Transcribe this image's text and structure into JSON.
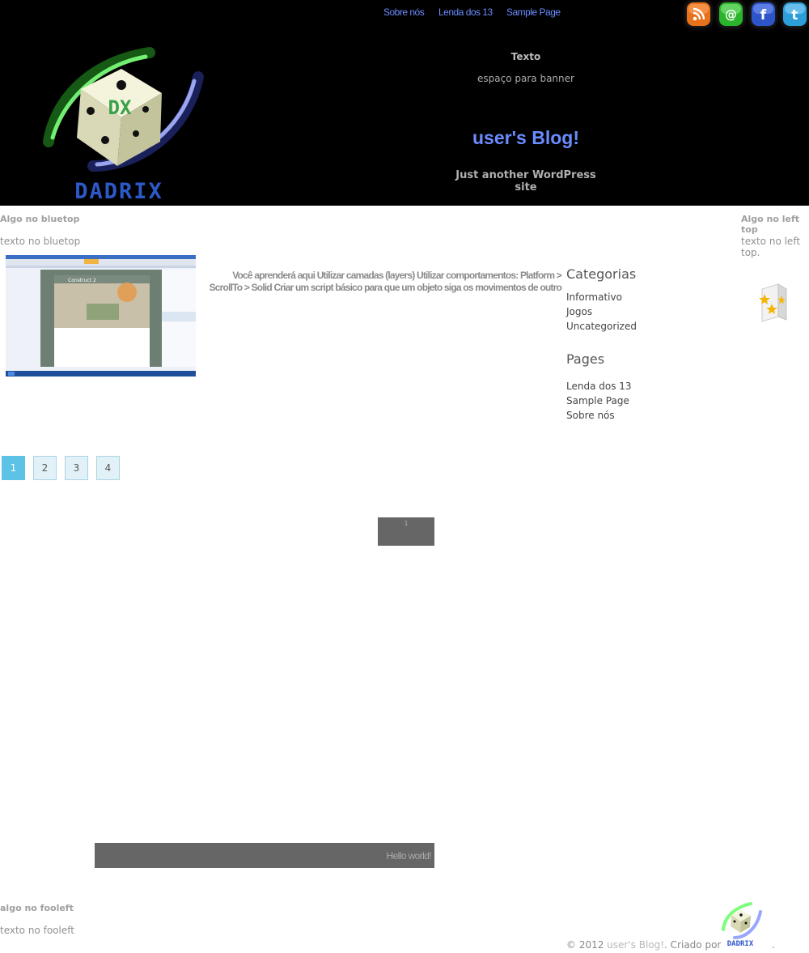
{
  "nav": {
    "items": [
      {
        "label": "Sobre nós"
      },
      {
        "label": "Lenda dos 13"
      },
      {
        "label": "Sample Page"
      }
    ]
  },
  "social_icons": [
    {
      "icon": "rss-icon",
      "color": "#e8721c"
    },
    {
      "icon": "email-icon",
      "color": "#2bb32b"
    },
    {
      "icon": "facebook-icon",
      "color": "#2d54c8"
    },
    {
      "icon": "twitter-icon",
      "color": "#2d9fd8"
    }
  ],
  "header": {
    "logo_text": "DADRIX",
    "logo_mark": "DX",
    "banner_title": "Texto",
    "banner_text": "espaço para banner",
    "site_title": "user's Blog!",
    "tagline": "Just another WordPress site"
  },
  "widgets": {
    "bluetop_title": "Algo no bluetop",
    "bluetop_text": "texto no bluetop",
    "lefttop_title": "Algo no left top",
    "lefttop_text": "texto no left top.",
    "fooleft_title": "algo no fooleft",
    "fooleft_text": "texto no fooleft"
  },
  "post": {
    "thumbnail_title": "Construct 2",
    "excerpt": "Você aprenderá aqui Utilizar camadas (layers) Utilizar comportamentos: Platform > ScrollTo > Solid Criar um script básico para que um objeto siga os movimentos de outro"
  },
  "sidebar": {
    "categories_title": "Categorias",
    "categories": [
      "Informativo",
      "Jogos",
      "Uncategorized"
    ],
    "pages_title": "Pages",
    "pages": [
      "Lenda dos 13",
      "Sample Page",
      "Sobre nós"
    ]
  },
  "pagination": {
    "pages": [
      "1",
      "2",
      "3",
      "4"
    ],
    "current": "1"
  },
  "boxes": {
    "box1_text": "1",
    "bar_text": "Hello world!"
  },
  "footer": {
    "copyright": "© 2012 ",
    "blog_link": "user's Blog!",
    "created_by": ". Criado por",
    "end": ".",
    "logo_text": "DADRIX"
  },
  "colors": {
    "header_bg": "#000000",
    "link_blue": "#6b8cff",
    "page_current": "#5cc3e6",
    "page_bg": "#e2f1f8",
    "box_gray": "#666666"
  }
}
